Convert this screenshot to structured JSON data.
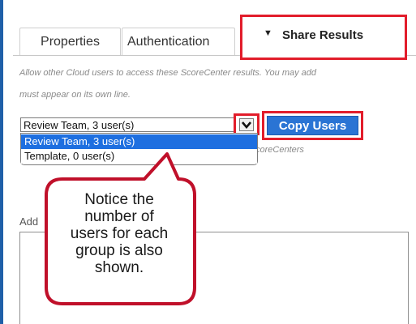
{
  "tabs": {
    "properties": "Properties",
    "authentication": "Authentication",
    "share_results": "Share Results",
    "share_caret": "▼"
  },
  "help": {
    "line1": "Allow other Cloud users to access these ScoreCenter results. You may add",
    "line2": "must appear on its own line."
  },
  "group_select": {
    "selected": "Review Team, 3 user(s)",
    "options": [
      "Review Team, 3 user(s)",
      "Template, 0 user(s)"
    ]
  },
  "copy_button": "Copy Users",
  "behind_text": "coreCenters",
  "add_label": "Add",
  "callout": {
    "lines": [
      "Notice the",
      "number of",
      "users for each",
      "group is also",
      "shown."
    ]
  },
  "colors": {
    "highlight": "#e21d2b",
    "button": "#2a74d4",
    "selected_option": "#1e6fe0",
    "left_border": "#1f5fa8"
  }
}
